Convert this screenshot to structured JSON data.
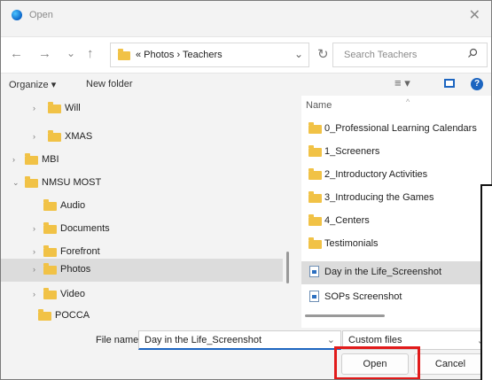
{
  "window": {
    "title": "Open",
    "close_glyph": "✕"
  },
  "nav": {
    "back": "←",
    "forward": "→",
    "recent": "⌄",
    "up": "↑",
    "refresh": "↻"
  },
  "address": {
    "text": "« Photos › Teachers",
    "chevron": "⌄"
  },
  "search": {
    "placeholder": "Search Teachers",
    "icon": "search-icon"
  },
  "toolbar": {
    "organize_label": "Organize ▾",
    "new_folder_label": "New folder",
    "view_glyph": "≡ ▾",
    "help_glyph": "?"
  },
  "tree": {
    "items": [
      {
        "label": "Will",
        "chevron": "›"
      },
      {
        "label": "XMAS",
        "chevron": "›"
      },
      {
        "label": "MBI",
        "chevron": "›"
      },
      {
        "label": "NMSU MOST",
        "chevron": "⌄"
      },
      {
        "label": "Audio",
        "chevron": ""
      },
      {
        "label": "Documents",
        "chevron": "›"
      },
      {
        "label": "Forefront",
        "chevron": "›"
      },
      {
        "label": "Photos",
        "chevron": "›",
        "selected": true
      },
      {
        "label": "Video",
        "chevron": "›"
      },
      {
        "label": "POCCA",
        "chevron": ""
      }
    ]
  },
  "files": {
    "column_name": "Name",
    "sort_caret": "^",
    "items": [
      {
        "label": "0_Professional Learning Calendars",
        "type": "folder"
      },
      {
        "label": "1_Screeners",
        "type": "folder"
      },
      {
        "label": "2_Introductory Activities",
        "type": "folder"
      },
      {
        "label": "3_Introducing the Games",
        "type": "folder"
      },
      {
        "label": "4_Centers",
        "type": "folder"
      },
      {
        "label": "Testimonials",
        "type": "folder"
      },
      {
        "label": "Day in the Life_Screenshot",
        "type": "image",
        "selected": true
      },
      {
        "label": "SOPs Screenshot",
        "type": "image"
      }
    ]
  },
  "footer": {
    "file_name_label": "File name:",
    "file_name_value": "Day in the Life_Screenshot",
    "file_name_chevron": "⌄",
    "filter_value": "Custom files",
    "filter_chevron": "⌄",
    "open_label": "Open",
    "cancel_label": "Cancel"
  },
  "colors": {
    "accent": "#1c65c0",
    "folder": "#f1c246",
    "highlight": "#e11a1a",
    "selection": "#dcdcdc"
  }
}
